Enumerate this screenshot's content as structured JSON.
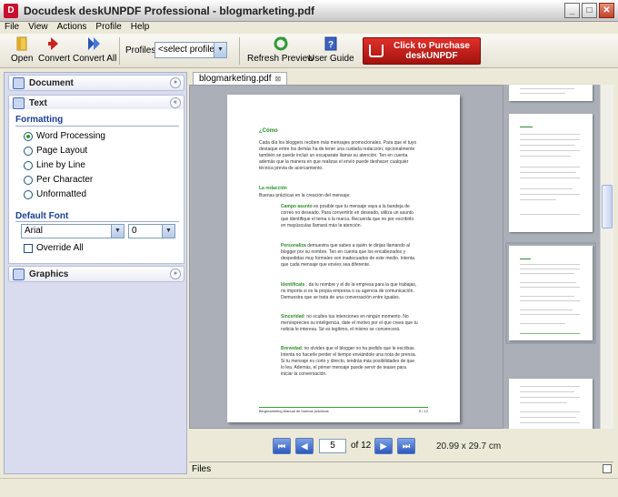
{
  "window": {
    "app_icon": "D",
    "title": "Docudesk deskUNPDF Professional - blogmarketing.pdf",
    "minimize_glyph": "_",
    "maximize_glyph": "□",
    "close_glyph": "✕"
  },
  "menu": [
    "File",
    "View",
    "Actions",
    "Profile",
    "Help"
  ],
  "toolbar": {
    "open": "Open",
    "convert": "Convert",
    "convert_all": "Convert All",
    "profiles_label": "Profiles",
    "profile_value": "<select profile>",
    "refresh_preview": "Refresh Preview",
    "user_guide": "User Guide",
    "purchase_line1": "Click to Purchase",
    "purchase_line2": "deskUNPDF",
    "icons": [
      "folder-icon",
      "arrow-right-icon",
      "double-arrow-icon",
      "refresh-icon",
      "help-book-icon",
      "cart-icon"
    ]
  },
  "left_panel": {
    "document": "Document",
    "text": "Text",
    "formatting": "Formatting",
    "options": [
      "Word Processing",
      "Page Layout",
      "Line by Line",
      "Per Character",
      "Unformatted"
    ],
    "selected_option": "Word Processing",
    "default_font": "Default Font",
    "font_name": "Arial",
    "font_size": "0",
    "override_all": "Override All",
    "graphics": "Graphics",
    "collapse_glyph": "«",
    "expand_glyph": "»",
    "dropdown_glyph": "▼"
  },
  "document_tab": {
    "label": "blogmarketing.pdf",
    "close_glyph": "⊠"
  },
  "page": {
    "heading": "¿Cómo",
    "intro": "Cada día los bloggers reciben más mensajes promocionales. Para que el tuyo\ndestaque entre los demás ha de tener una cuidada redacción, opcionalmente\ntambién se puede incluir un escaparate llamar su atención. Ten en cuenta\nademás que la manera en que realizas el envío puede deshacer cualquier\ntécnica previa de acercamiento.",
    "section_title": "La redacción",
    "section_sub": "Buenas prácticas en la creación del mensaje:",
    "p1_label": "Campo asunto",
    "p1": " es posible que tu mensaje vaya a la bandeja de\ncorreo no deseado. Para convertirlo en deseado, utiliza un asunto\nque identifique el tema o la marca. Recuerda que no por escribirlo\nen mayúsculas llamará más la atención.",
    "p2_label": "Personaliza",
    "p2": " demuestra que sabes a quién te dirijas llamando al\nblogger por su nombre. Ten en cuenta que los encabezados y\ndespedidas muy formales son inadecuados de este medio. Intenta\nque cada mensaje que envíes sea diferente.",
    "p3_label": "Identifícate",
    "p3": " : da tu nombre y el de la empresa para la que trabajas,\nno importa si es la propia empresa o su agencia de comunicación.\nDemuestra que se trata de una conversación entre iguales.",
    "p4_label": "Sinceridad",
    "p4": ": no ocultes tus intenciones en ningún momento. No\nmenosprecies su inteligencia, date el motivo por el que crees que tu\nnoticia le interesa. Sé es legítimo, el mismo se convencerá.",
    "p5_label": "Brevedad",
    "p5": ": no olvides que el blogger no ha pedido que le escribas.\nIntenta no hacerle perder el tiempo enviándole una nota de prensa.\nSi tu mensaje es corto y directo, tendrás más posibilidades de que\nlo lea. Además, el primer mensaje puede servir de teaser para\niniciar la conversación.",
    "footer_left": "Blogmarketing Manual de buenas prácticas",
    "footer_right": "5 / 12"
  },
  "navigation": {
    "first_glyph": "⏮",
    "prev_glyph": "◀",
    "next_glyph": "▶",
    "last_glyph": "⏭",
    "current_page": "5",
    "of_text": "of 12",
    "page_size": "20.99 x 29.7 cm"
  },
  "files_tab": "Files",
  "colors": {
    "accent_green": "#2a8f2a",
    "purchase_red": "#c8102e",
    "panel_blue": "#d8dcee"
  }
}
